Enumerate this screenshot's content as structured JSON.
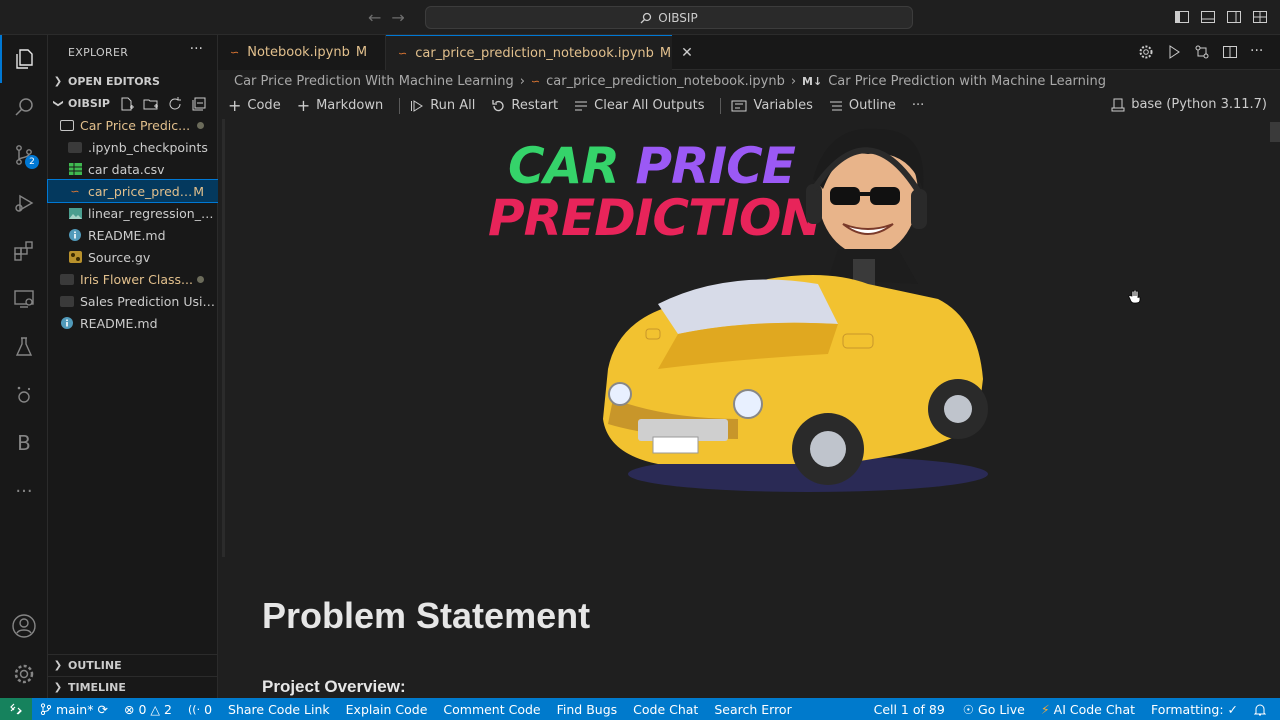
{
  "titlebar": {
    "search_text": "OIBSIP"
  },
  "activitybar": {
    "scm_badge": "2"
  },
  "explorer": {
    "title": "EXPLORER",
    "open_editors": "OPEN EDITORS",
    "workspace": "OIBSIP",
    "items": [
      {
        "label": "Car Price Predic...",
        "type": "folder"
      },
      {
        "label": ".ipynb_checkpoints",
        "type": "folder"
      },
      {
        "label": "car data.csv",
        "type": "csv"
      },
      {
        "label": "car_price_predi...",
        "type": "notebook",
        "status": "M"
      },
      {
        "label": "linear_regression_co...",
        "type": "image"
      },
      {
        "label": "README.md",
        "type": "info"
      },
      {
        "label": "Source.gv",
        "type": "graphviz"
      },
      {
        "label": "Iris Flower Class...",
        "type": "folder"
      },
      {
        "label": "Sales Prediction Usin...",
        "type": "folder"
      },
      {
        "label": "README.md",
        "type": "info"
      }
    ],
    "outline": "OUTLINE",
    "timeline": "TIMELINE"
  },
  "tabs": [
    {
      "label": "Notebook.ipynb",
      "status": "M"
    },
    {
      "label": "car_price_prediction_notebook.ipynb",
      "status": "M"
    }
  ],
  "breadcrumb": {
    "folder": "Car Price Prediction With Machine Learning",
    "file": "car_price_prediction_notebook.ipynb",
    "md_prefix": "M↓",
    "section": "Car Price Prediction with Machine Learning"
  },
  "toolbar": {
    "code": "Code",
    "markdown": "Markdown",
    "run_all": "Run All",
    "restart": "Restart",
    "clear_outputs": "Clear All Outputs",
    "variables": "Variables",
    "outline": "Outline",
    "more": "···",
    "kernel": "base (Python 3.11.7)"
  },
  "notebook": {
    "banner_word1": "CAR",
    "banner_word2": "PRICE",
    "banner_word3": "PREDICTION",
    "heading": "Problem Statement",
    "subheading": "Project Overview:"
  },
  "statusbar": {
    "branch": "main*",
    "errors": "0",
    "warnings": "2",
    "ports": "0",
    "share": "Share Code Link",
    "explain": "Explain Code",
    "comment": "Comment Code",
    "bugs": "Find Bugs",
    "chat": "Code Chat",
    "search_error": "Search Error",
    "cell": "Cell 1 of 89",
    "go_live": "Go Live",
    "ai_chat": "AI Code Chat",
    "formatting": "Formatting: ✓"
  },
  "colors": {
    "accent": "#0078d4",
    "statusbar": "#007acc",
    "modified": "#e2c08d",
    "banner_green": "#35d36a",
    "banner_purple": "#9b59f5",
    "banner_red": "#e8245a",
    "car_yellow": "#f2c230"
  }
}
